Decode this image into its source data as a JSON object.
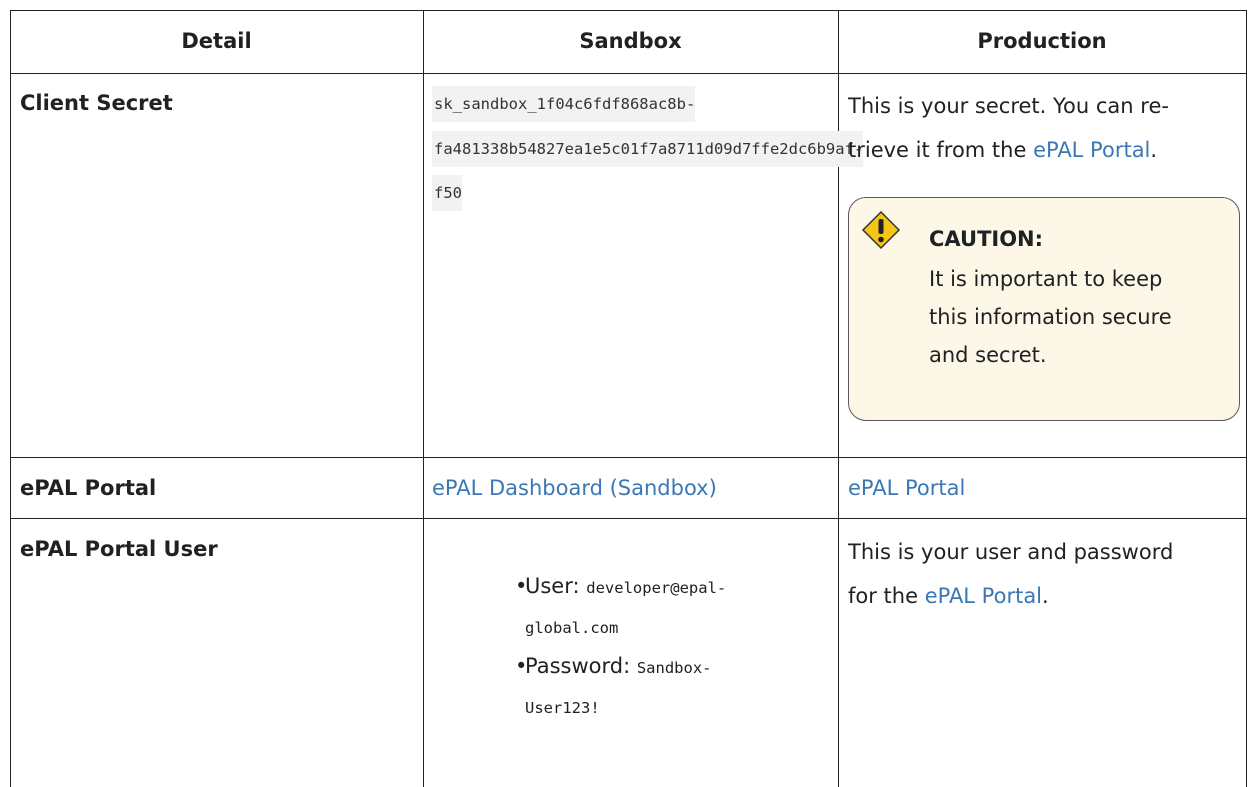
{
  "table": {
    "headers": {
      "detail": "Detail",
      "sandbox": "Sandbox",
      "production": "Production"
    },
    "rows": {
      "client_secret": {
        "detail": "Client Secret",
        "sandbox_code": [
          "sk_sandbox_1f04c6fdf868ac8b-",
          "fa481338b54827ea1e5c01f7a8711d09d7ffe2dc6b9af-",
          "f50"
        ],
        "production_text_1": "This is your secret. You can re-",
        "production_text_2": "trieve it from the ",
        "production_link": "ePAL Portal",
        "production_text_3": ".",
        "caution": {
          "title": "CAUTION:",
          "lines": [
            "It is important to keep",
            "this information secure",
            "and secret."
          ]
        }
      },
      "epal_portal": {
        "detail": "ePAL Portal",
        "sandbox_link": "ePAL Dashboard (Sandbox)",
        "production_link": "ePAL Portal"
      },
      "epal_portal_user": {
        "detail": "ePAL Portal User",
        "user_label": "User: ",
        "user_value_1": "developer@epal-",
        "user_value_2": "global.com",
        "password_label": "Password: ",
        "password_value_1": "Sandbox-",
        "password_value_2": "User123!",
        "production_text_1": "This is your user and password",
        "production_text_2": "for the ",
        "production_link": "ePAL Portal",
        "production_text_3": "."
      }
    }
  },
  "colors": {
    "link": "#3a78b5",
    "caution_bg": "#fcf7e6",
    "caution_icon": "#f5c518"
  }
}
